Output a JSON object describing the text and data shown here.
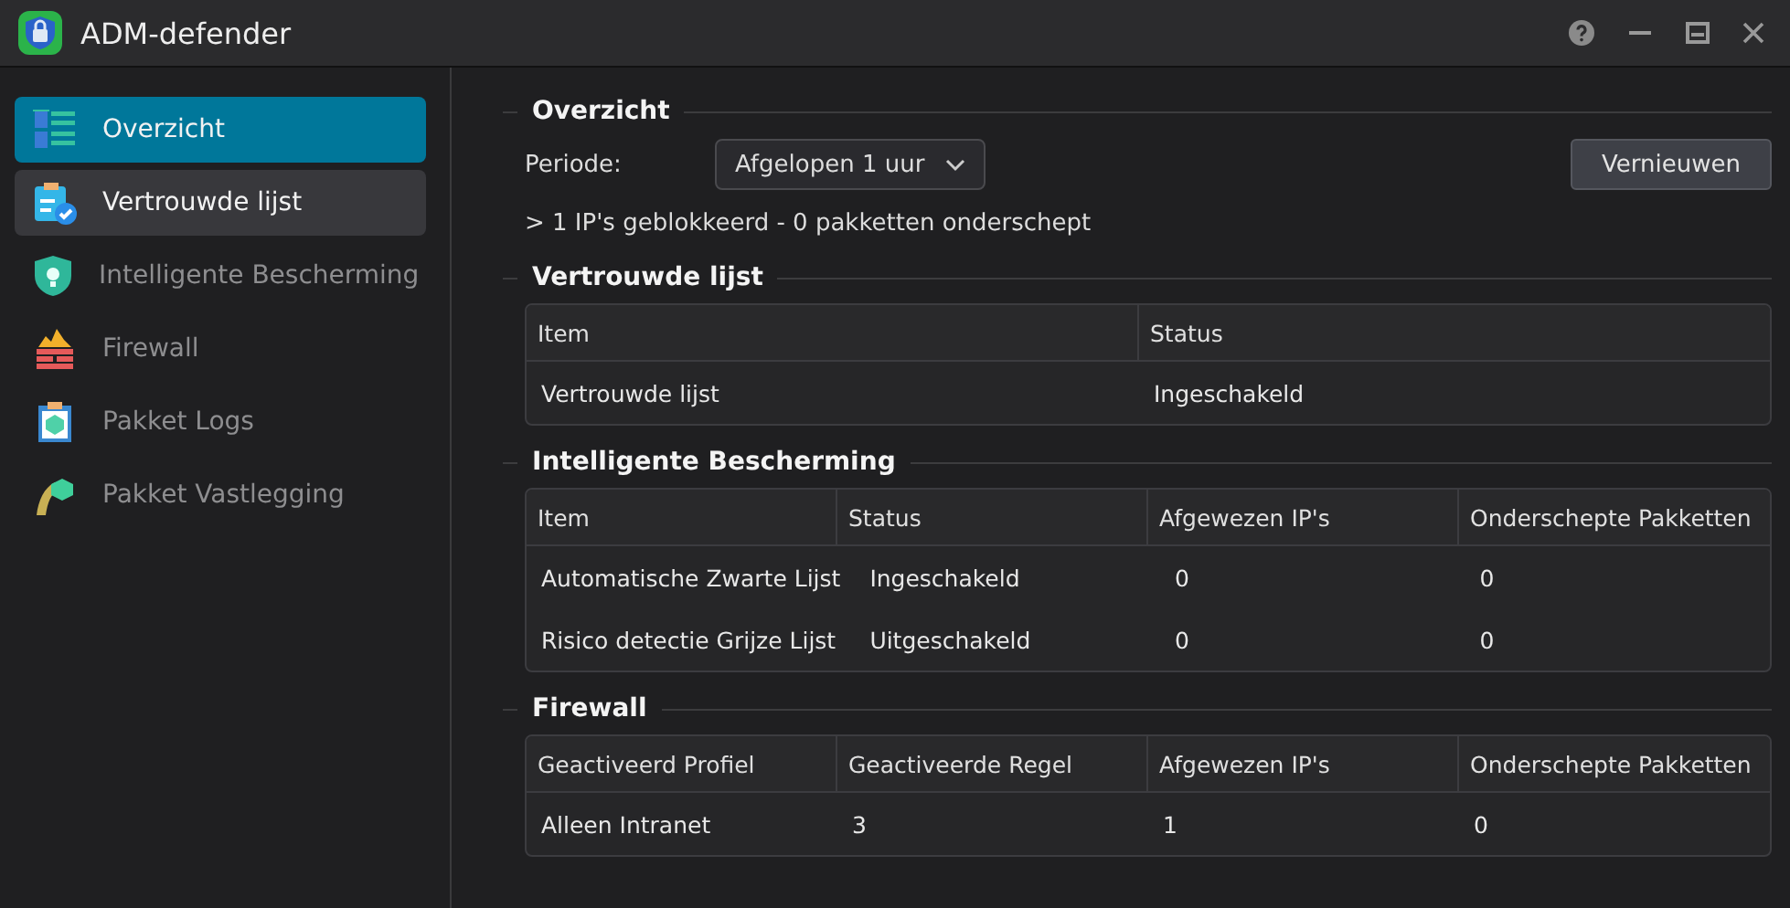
{
  "window": {
    "title": "ADM-defender"
  },
  "sidebar": {
    "items": [
      {
        "label": "Overzicht",
        "selected": true,
        "hovered": false
      },
      {
        "label": "Vertrouwde lijst",
        "selected": false,
        "hovered": true
      },
      {
        "label": "Intelligente Bescherming",
        "selected": false,
        "hovered": false
      },
      {
        "label": "Firewall",
        "selected": false,
        "hovered": false
      },
      {
        "label": "Pakket Logs",
        "selected": false,
        "hovered": false
      },
      {
        "label": "Pakket Vastlegging",
        "selected": false,
        "hovered": false
      }
    ]
  },
  "overview": {
    "title": "Overzicht",
    "period_label": "Periode:",
    "period_value": "Afgelopen 1 uur",
    "refresh_button": "Vernieuwen",
    "summary": "> 1 IP's geblokkeerd - 0 pakketten onderschept"
  },
  "sections": [
    {
      "title": "Vertrouwde lijst",
      "columns": [
        "Item",
        "Status"
      ],
      "rows": [
        [
          "Vertrouwde lijst",
          "Ingeschakeld"
        ]
      ]
    },
    {
      "title": "Intelligente Bescherming",
      "columns": [
        "Item",
        "Status",
        "Afgewezen IP's",
        "Onderschepte Pakketten"
      ],
      "rows": [
        [
          "Automatische Zwarte Lijst",
          "Ingeschakeld",
          "0",
          "0"
        ],
        [
          "Risico detectie Grijze Lijst",
          "Uitgeschakeld",
          "0",
          "0"
        ]
      ]
    },
    {
      "title": "Firewall",
      "columns": [
        "Geactiveerd Profiel",
        "Geactiveerde Regel",
        "Afgewezen IP's",
        "Onderschepte Pakketten"
      ],
      "rows": [
        [
          "Alleen Intranet",
          "3",
          "1",
          "0"
        ]
      ]
    }
  ]
}
